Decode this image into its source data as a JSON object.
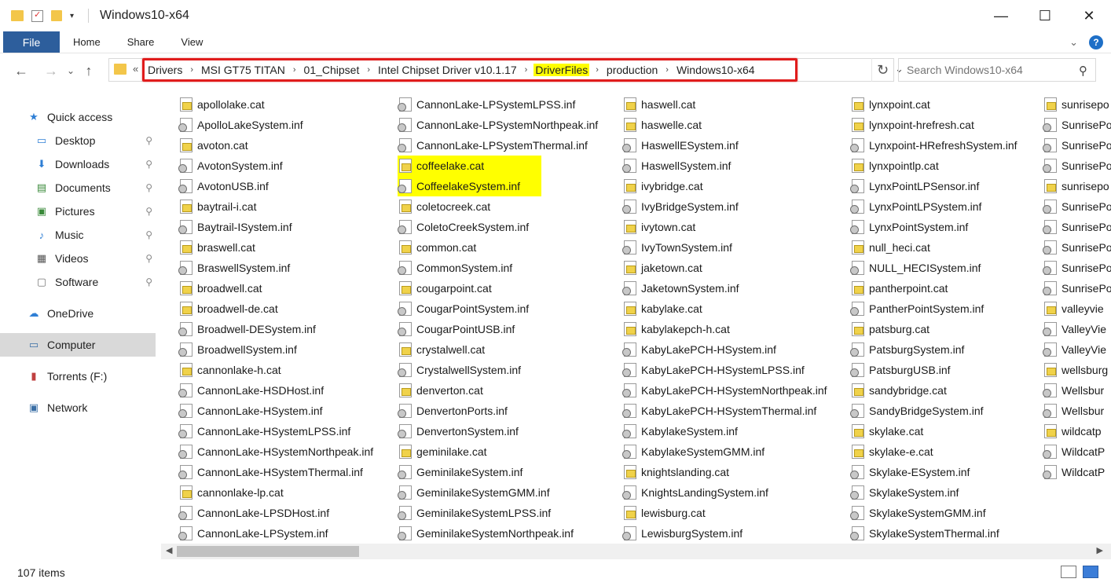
{
  "window": {
    "title": "Windows10-x64",
    "controls": {
      "minimize": "—",
      "maximize": "☐",
      "close": "✕"
    }
  },
  "ribbon": {
    "tabs": [
      "File",
      "Home",
      "Share",
      "View"
    ]
  },
  "address": {
    "crumbs": [
      "Drivers",
      "MSI GT75 TITAN",
      "01_Chipset",
      "Intel Chipset Driver v10.1.17",
      "DriverFiles",
      "production",
      "Windows10-x64"
    ],
    "highlighted_crumb": "DriverFiles"
  },
  "search": {
    "placeholder": "Search Windows10-x64"
  },
  "nav": {
    "items": [
      {
        "label": "Quick access",
        "icon": "star-icon"
      },
      {
        "label": "Desktop",
        "icon": "desktop-icon",
        "pinned": true
      },
      {
        "label": "Downloads",
        "icon": "download-icon",
        "pinned": true
      },
      {
        "label": "Documents",
        "icon": "documents-icon",
        "pinned": true
      },
      {
        "label": "Pictures",
        "icon": "pictures-icon",
        "pinned": true
      },
      {
        "label": "Music",
        "icon": "music-icon",
        "pinned": true
      },
      {
        "label": "Videos",
        "icon": "videos-icon",
        "pinned": true
      },
      {
        "label": "Software",
        "icon": "software-icon",
        "pinned": true
      },
      {
        "label": "OneDrive",
        "icon": "onedrive-icon"
      },
      {
        "label": "Computer",
        "icon": "computer-icon",
        "selected": true
      },
      {
        "label": "Torrents (F:)",
        "icon": "sd-card-icon"
      },
      {
        "label": "Network",
        "icon": "network-icon"
      }
    ]
  },
  "files": {
    "col1": [
      "apollolake.cat",
      "ApolloLakeSystem.inf",
      "avoton.cat",
      "AvotonSystem.inf",
      "AvotonUSB.inf",
      "baytrail-i.cat",
      "Baytrail-ISystem.inf",
      "braswell.cat",
      "BraswellSystem.inf",
      "broadwell.cat",
      "broadwell-de.cat",
      "Broadwell-DESystem.inf",
      "BroadwellSystem.inf",
      "cannonlake-h.cat",
      "CannonLake-HSDHost.inf",
      "CannonLake-HSystem.inf",
      "CannonLake-HSystemLPSS.inf",
      "CannonLake-HSystemNorthpeak.inf",
      "CannonLake-HSystemThermal.inf",
      "cannonlake-lp.cat",
      "CannonLake-LPSDHost.inf",
      "CannonLake-LPSystem.inf"
    ],
    "col2": [
      "CannonLake-LPSystemLPSS.inf",
      "CannonLake-LPSystemNorthpeak.inf",
      "CannonLake-LPSystemThermal.inf",
      "coffeelake.cat",
      "CoffeelakeSystem.inf",
      "coletocreek.cat",
      "ColetoCreekSystem.inf",
      "common.cat",
      "CommonSystem.inf",
      "cougarpoint.cat",
      "CougarPointSystem.inf",
      "CougarPointUSB.inf",
      "crystalwell.cat",
      "CrystalwellSystem.inf",
      "denverton.cat",
      "DenvertonPorts.inf",
      "DenvertonSystem.inf",
      "geminilake.cat",
      "GeminilakeSystem.inf",
      "GeminilakeSystemGMM.inf",
      "GeminilakeSystemLPSS.inf",
      "GeminilakeSystemNorthpeak.inf"
    ],
    "col3": [
      "haswell.cat",
      "haswelle.cat",
      "HaswellESystem.inf",
      "HaswellSystem.inf",
      "ivybridge.cat",
      "IvyBridgeSystem.inf",
      "ivytown.cat",
      "IvyTownSystem.inf",
      "jaketown.cat",
      "JaketownSystem.inf",
      "kabylake.cat",
      "kabylakepch-h.cat",
      "KabyLakePCH-HSystem.inf",
      "KabyLakePCH-HSystemLPSS.inf",
      "KabyLakePCH-HSystemNorthpeak.inf",
      "KabyLakePCH-HSystemThermal.inf",
      "KabylakeSystem.inf",
      "KabylakeSystemGMM.inf",
      "knightslanding.cat",
      "KnightsLandingSystem.inf",
      "lewisburg.cat",
      "LewisburgSystem.inf"
    ],
    "col4": [
      "lynxpoint.cat",
      "lynxpoint-hrefresh.cat",
      "Lynxpoint-HRefreshSystem.inf",
      "lynxpointlp.cat",
      "LynxPointLPSensor.inf",
      "LynxPointLPSystem.inf",
      "LynxPointSystem.inf",
      "null_heci.cat",
      "NULL_HECISystem.inf",
      "pantherpoint.cat",
      "PantherPointSystem.inf",
      "patsburg.cat",
      "PatsburgSystem.inf",
      "PatsburgUSB.inf",
      "sandybridge.cat",
      "SandyBridgeSystem.inf",
      "skylake.cat",
      "skylake-e.cat",
      "Skylake-ESystem.inf",
      "SkylakeSystem.inf",
      "SkylakeSystemGMM.inf",
      "SkylakeSystemThermal.inf"
    ],
    "col5": [
      "sunrisepo",
      "SunrisePo",
      "SunrisePo",
      "SunrisePo",
      "sunrisepo",
      "SunrisePo",
      "SunrisePo",
      "SunrisePo",
      "SunrisePo",
      "SunrisePo",
      "valleyvie",
      "ValleyVie",
      "ValleyVie",
      "wellsburg",
      "Wellsbur",
      "Wellsbur",
      "wildcatp",
      "WildcatP",
      "WildcatP"
    ],
    "col5_types": [
      "cat",
      "inf",
      "inf",
      "inf",
      "cat",
      "inf",
      "inf",
      "inf",
      "inf",
      "inf",
      "cat",
      "inf",
      "inf",
      "cat",
      "inf",
      "inf",
      "cat",
      "inf",
      "inf"
    ],
    "highlighted": [
      "coffeelake.cat",
      "CoffeelakeSystem.inf"
    ]
  },
  "status": {
    "item_count": "107 items"
  },
  "colors": {
    "file_tab": "#2d5e9c",
    "highlight": "#ffff00",
    "address_outline": "#e01c1c"
  }
}
